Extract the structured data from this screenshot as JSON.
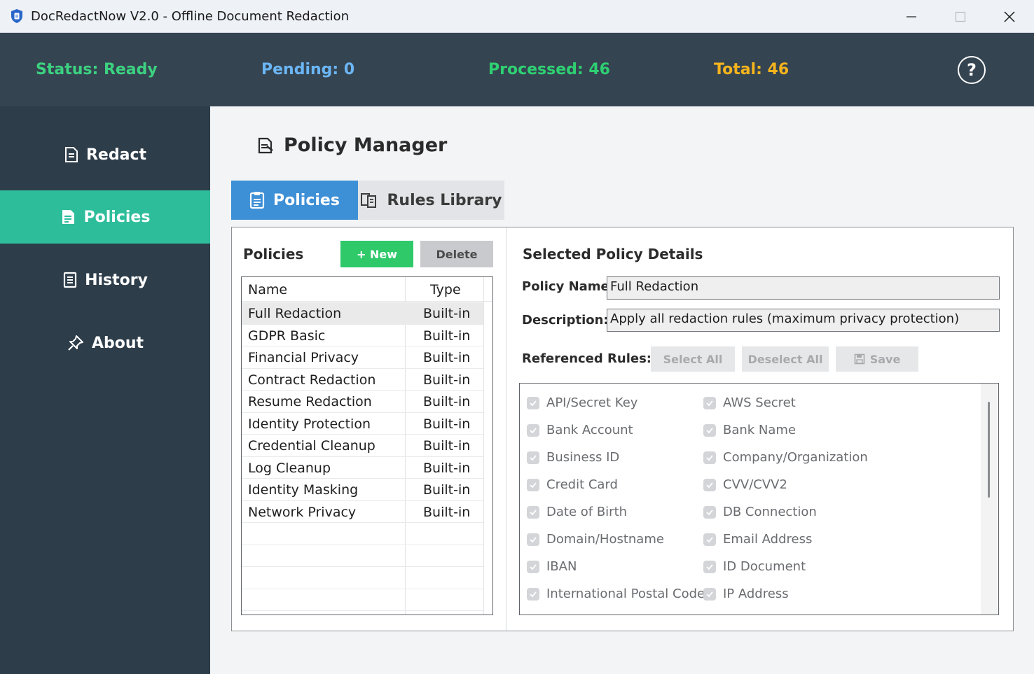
{
  "window": {
    "title": "DocRedactNow V2.0 - Offline Document Redaction",
    "minimize": "─",
    "maximize": "☐",
    "close": "✕"
  },
  "status": {
    "status_text": "Status: Ready",
    "pending_text": "Pending: 0",
    "processed_text": "Processed: 46",
    "total_text": "Total: 46",
    "help": "?",
    "colors": {
      "status": "#3cd180",
      "pending": "#6bb6f5",
      "processed": "#2ed072",
      "total": "#f5b41d"
    }
  },
  "sidebar": {
    "items": [
      {
        "label": "Redact",
        "icon": "document-icon",
        "active": false
      },
      {
        "label": "Policies",
        "icon": "policy-icon",
        "active": true
      },
      {
        "label": "History",
        "icon": "history-icon",
        "active": false
      },
      {
        "label": "About",
        "icon": "pin-icon",
        "active": false
      }
    ]
  },
  "main": {
    "title": "Policy Manager",
    "tabs": [
      {
        "label": "Policies",
        "active": true
      },
      {
        "label": "Rules Library",
        "active": false
      }
    ],
    "policies_panel": {
      "label": "Policies",
      "new_button": "+ New",
      "delete_button": "Delete",
      "columns": [
        "Name",
        "Type"
      ],
      "rows": [
        {
          "name": "Full Redaction",
          "type": "Built-in"
        },
        {
          "name": "GDPR Basic",
          "type": "Built-in"
        },
        {
          "name": "Financial Privacy",
          "type": "Built-in"
        },
        {
          "name": "Contract Redaction",
          "type": "Built-in"
        },
        {
          "name": "Resume Redaction",
          "type": "Built-in"
        },
        {
          "name": "Identity Protection",
          "type": "Built-in"
        },
        {
          "name": "Credential Cleanup",
          "type": "Built-in"
        },
        {
          "name": "Log Cleanup",
          "type": "Built-in"
        },
        {
          "name": "Identity Masking",
          "type": "Built-in"
        },
        {
          "name": "Network Privacy",
          "type": "Built-in"
        }
      ]
    },
    "details": {
      "title": "Selected Policy Details",
      "policy_name_label": "Policy Name:",
      "policy_name_value": "Full Redaction",
      "description_label": "Description:",
      "description_value": "Apply all redaction rules (maximum privacy protection)",
      "referenced_rules_label": "Referenced Rules:",
      "select_all": "Select All",
      "deselect_all": "Deselect All",
      "save": "Save",
      "rules_left": [
        "API/Secret Key",
        "Bank Account",
        "Business ID",
        "Credit Card",
        "Date of Birth",
        "Domain/Hostname",
        "IBAN",
        "International Postal Code"
      ],
      "rules_right": [
        "AWS Secret",
        "Bank Name",
        "Company/Organization",
        "CVV/CVV2",
        "DB Connection",
        "Email Address",
        "ID Document",
        "IP Address"
      ]
    }
  }
}
